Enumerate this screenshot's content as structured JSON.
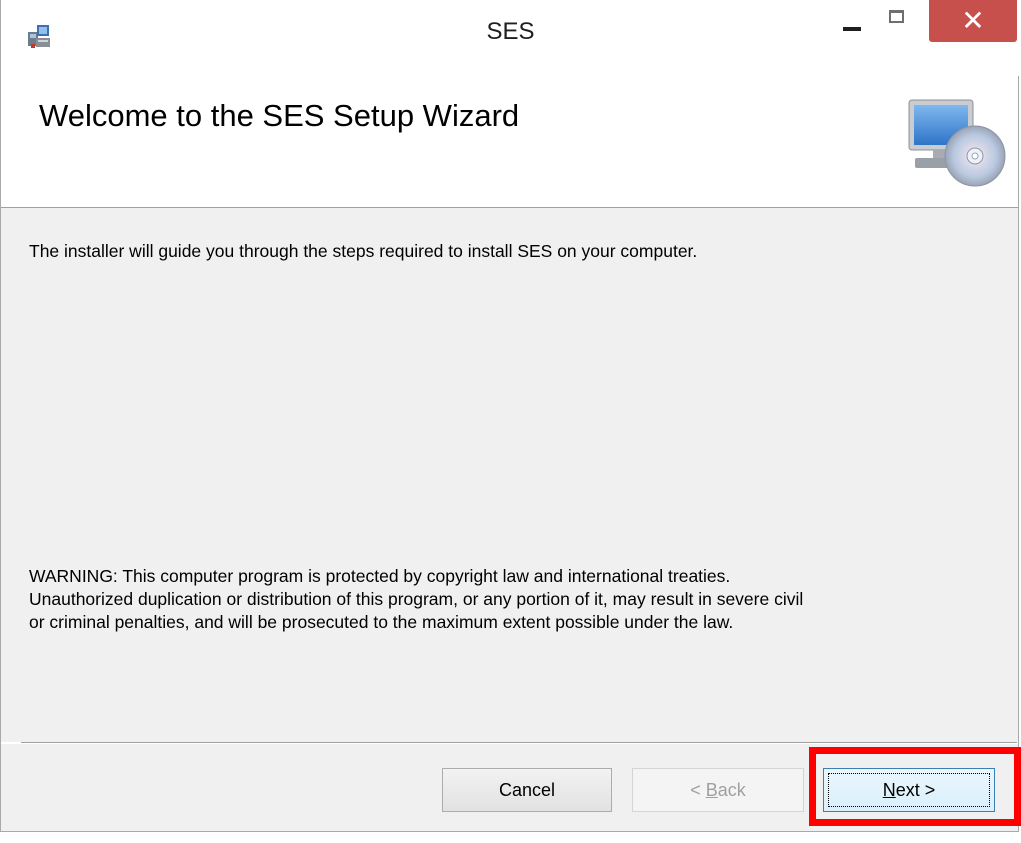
{
  "window": {
    "title": "SES"
  },
  "titlebar_buttons": {
    "close_glyph": "✕"
  },
  "banner": {
    "title": "Welcome to the SES Setup Wizard",
    "icon": "computer-cd-icon"
  },
  "body": {
    "intro": "The installer will guide you through the steps required to install SES on your computer.",
    "warning_lines": [
      "WARNING: This computer program is protected by copyright law and international treaties.",
      "Unauthorized duplication or distribution of this program, or any portion of it, may result in severe civil",
      "or criminal penalties, and will be prosecuted to the maximum extent possible under the law."
    ]
  },
  "buttons": {
    "cancel": "Cancel",
    "back_prefix": "< ",
    "back_accel": "B",
    "back_rest": "ack",
    "next_accel": "N",
    "next_rest": "ext >"
  },
  "colors": {
    "close_button": "#c7504c",
    "highlight": "#ff0000",
    "body_bg": "#f0f0f0"
  }
}
